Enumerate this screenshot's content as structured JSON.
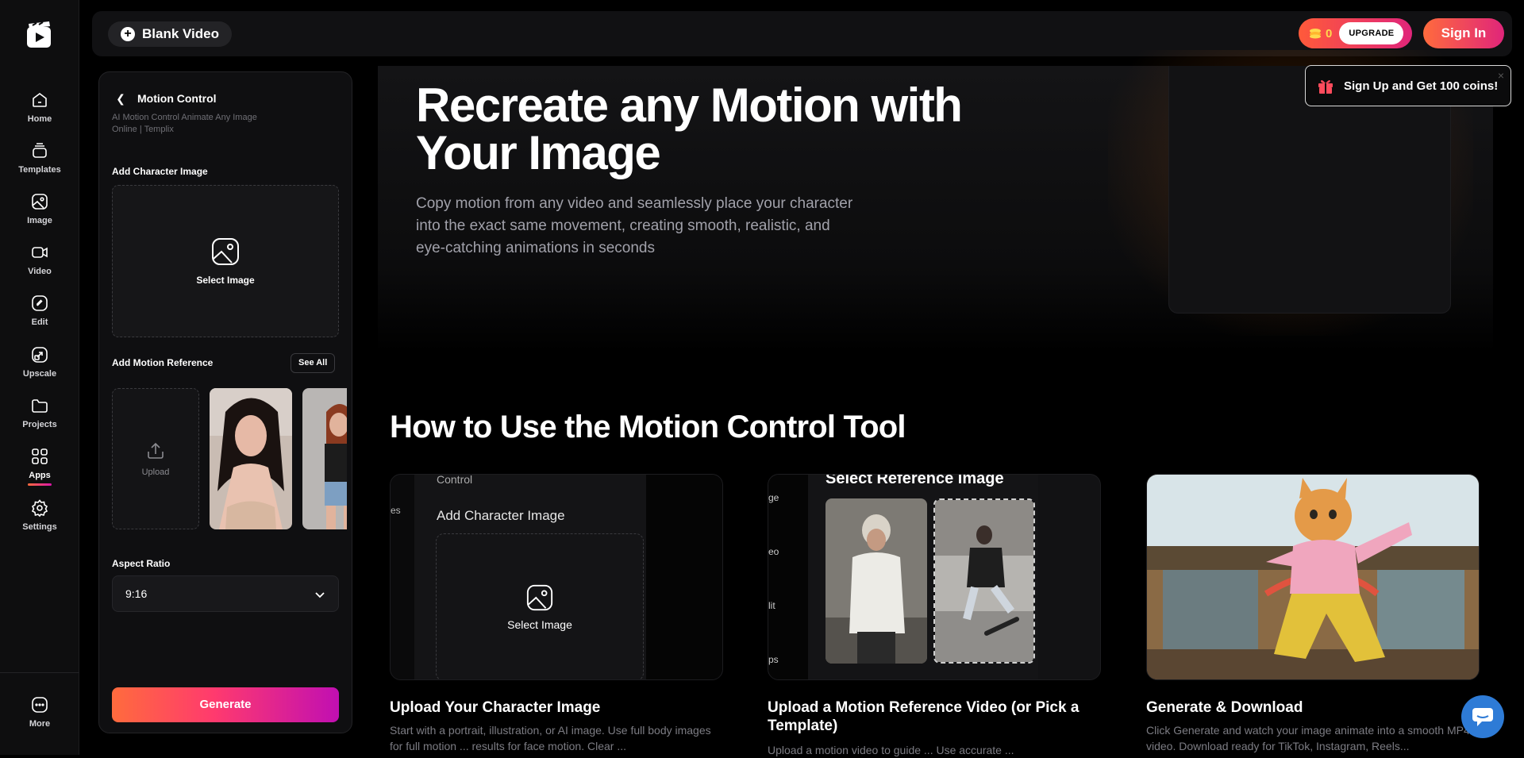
{
  "rail": {
    "items": [
      {
        "label": "Home",
        "icon": "home-icon"
      },
      {
        "label": "Templates",
        "icon": "templates-icon"
      },
      {
        "label": "Image",
        "icon": "image-icon"
      },
      {
        "label": "Video",
        "icon": "video-icon"
      },
      {
        "label": "Edit",
        "icon": "edit-icon"
      },
      {
        "label": "Upscale",
        "icon": "upscale-icon"
      },
      {
        "label": "Projects",
        "icon": "folder-icon"
      },
      {
        "label": "Apps",
        "icon": "apps-icon",
        "active": true
      },
      {
        "label": "Settings",
        "icon": "gear-icon"
      }
    ],
    "more_label": "More"
  },
  "topbar": {
    "blank_video_label": "Blank Video",
    "coins": "0",
    "upgrade_label": "UPGRADE",
    "signin_label": "Sign In"
  },
  "toast": {
    "text": "Sign Up and Get 100 coins!",
    "close": "×"
  },
  "panel": {
    "title": "Motion Control",
    "subtitle": "AI Motion Control Animate Any Image Online | Templix",
    "add_character_label": "Add Character Image",
    "select_image_label": "Select Image",
    "add_motion_label": "Add Motion Reference",
    "see_all_label": "See All",
    "upload_label": "Upload",
    "aspect_label": "Aspect Ratio",
    "aspect_value": "9:16",
    "generate_label": "Generate"
  },
  "hero": {
    "title": "Recreate any Motion with Your Image",
    "description": "Copy motion from any video and seamlessly place your character into the exact same movement, creating smooth, realistic, and eye-catching animations in seconds"
  },
  "howto": {
    "title": "How to Use the Motion Control Tool",
    "steps": [
      {
        "title": "Upload Your Character Image",
        "desc": "Start with a portrait, illustration, or AI image. Use full body images for full motion ... results for face motion. Clear ..."
      },
      {
        "title": "Upload a Motion Reference Video (or Pick a Template)",
        "desc": "Upload a motion video to guide ... Use accurate ..."
      },
      {
        "title": "Generate & Download",
        "desc": "Click Generate and watch your image animate into a smooth MP4 video. Download ready for TikTok, Instagram, Reels..."
      }
    ],
    "card1": {
      "control": "Control",
      "es": "es",
      "add": "Add Character Image",
      "select": "Select Image"
    },
    "card2": {
      "title": "Select Reference Image",
      "labels": [
        "ge",
        "eo",
        "lit",
        "ps"
      ]
    }
  },
  "colors": {
    "accent_start": "#ff6b3d",
    "accent_end": "#d915a8",
    "coin": "#ffd84d"
  }
}
